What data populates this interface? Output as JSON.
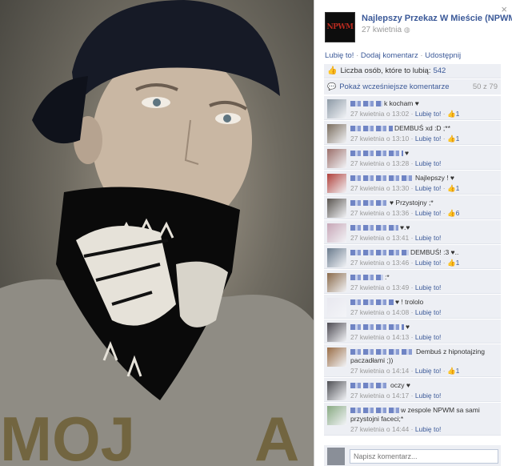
{
  "close_glyph": "×",
  "page": {
    "name": "Najlepszy Przekaz W Mieście (NPWM)",
    "date": "27 kwietnia",
    "globe": "◍",
    "thumb_text": "NPWM"
  },
  "actions": {
    "like": "Lubię to!",
    "comment": "Dodaj komentarz",
    "share": "Udostępnij",
    "sep": " · "
  },
  "likes": {
    "label": "Liczba osób, które to lubią:",
    "count": "542"
  },
  "previous": {
    "label": "Pokaż wcześniejsze komentarze",
    "count": "50 z 79"
  },
  "like_link": "Lubię to!",
  "comments": [
    {
      "text": "k kocham ♥",
      "time": "27 kwietnia o 13:02",
      "likes": "1",
      "avatar_color": "#8d9aa6"
    },
    {
      "text": "DEMBUŚ xd :D ;**",
      "time": "27 kwietnia o 13:10",
      "likes": "1",
      "avatar_color": "#7a6d5e"
    },
    {
      "text": "♥",
      "time": "27 kwietnia o 13:28",
      "likes": "",
      "avatar_color": "#9c6f6a"
    },
    {
      "text": "Najlepszy ! ♥",
      "time": "27 kwietnia o 13:30",
      "likes": "1",
      "avatar_color": "#b0403a"
    },
    {
      "text": "♥ Przystojny ;*",
      "time": "27 kwietnia o 13:36",
      "likes": "6",
      "avatar_color": "#5a5550"
    },
    {
      "text": "♥.♥",
      "time": "27 kwietnia o 13:41",
      "likes": "",
      "avatar_color": "#c7a6b6"
    },
    {
      "text": "DEMBUŚ! :3 ♥..",
      "time": "27 kwietnia o 13:46",
      "likes": "1",
      "avatar_color": "#6a7b8d"
    },
    {
      "text": ":*",
      "time": "27 kwietnia o 13:49",
      "likes": "",
      "avatar_color": "#8a6a4a"
    },
    {
      "text": "♥ ! trololo",
      "time": "27 kwietnia o 14:08",
      "likes": "",
      "avatar_color": "#e8e8ef"
    },
    {
      "text": "♥",
      "time": "27 kwietnia o 14:13",
      "likes": "",
      "avatar_color": "#4d4a52"
    },
    {
      "text": "Dembuś z hipnotajzing paczadłami ;))",
      "time": "27 kwietnia o 14:14",
      "likes": "1",
      "avatar_color": "#9a6d46"
    },
    {
      "text": "oczy ♥",
      "time": "27 kwietnia o 14:17",
      "likes": "",
      "avatar_color": "#4f5055"
    },
    {
      "text": "w zespole NPWM sa sami przystojni faceci;*",
      "time": "27 kwietnia o 14:44",
      "likes": "",
      "avatar_color": "#88aa82"
    }
  ],
  "input": {
    "placeholder": "Napisz komentarz..."
  }
}
